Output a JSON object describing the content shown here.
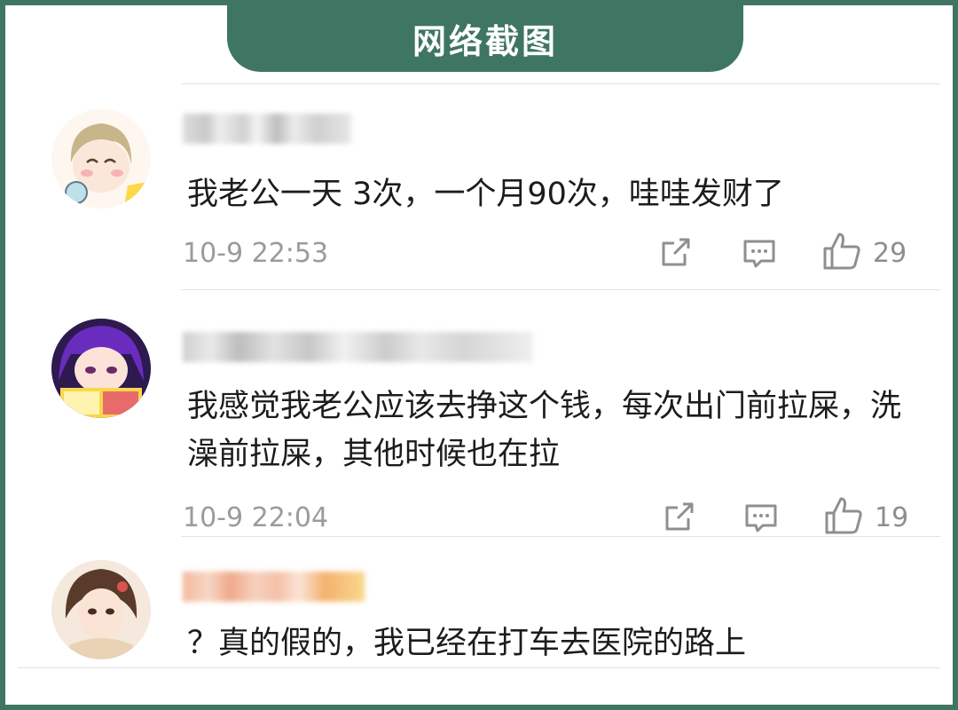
{
  "header": {
    "title": "网络截图"
  },
  "comments": [
    {
      "username": "",
      "text": "我老公一天 3次，一个月90次，哇哇发财了",
      "time": "10-9 22:53",
      "likes": "29"
    },
    {
      "username": "",
      "text": "我感觉我老公应该去挣这个钱，每次出门前拉屎，洗澡前拉屎，其他时候也在拉",
      "time": "10-9 22:04",
      "likes": "19"
    },
    {
      "username": "",
      "text": "？真的假的，我已经在打车去医院的路上"
    }
  ],
  "icons": {
    "share": "share-icon",
    "reply": "comment-icon",
    "like": "thumbs-up-icon"
  },
  "colors": {
    "frame": "#3f7563",
    "text": "#1c1c1c",
    "meta": "#9b9b9b"
  }
}
